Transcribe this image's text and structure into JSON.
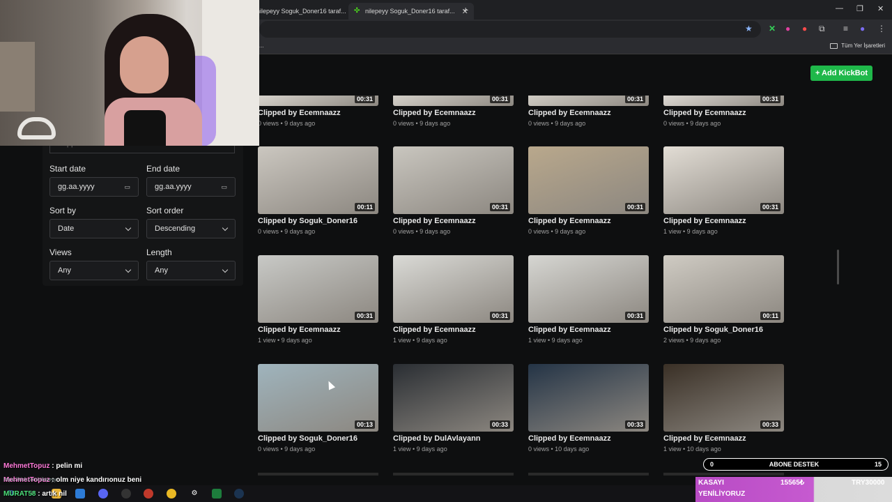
{
  "browser": {
    "tabs": [
      {
        "label": "nilepeyy Soguk_Doner16 taraf..."
      },
      {
        "label": "nilepeyy Soguk_Doner16 taraf..."
      }
    ],
    "new_tab": "+",
    "bookmarks_all": "Tüm Yer İşaretleri",
    "bookmarks_left": "..."
  },
  "header": {
    "add_kickbot": "+ Add KickBot"
  },
  "filters": {
    "clipper_placeholder": "Clipper username",
    "start_date_label": "Start date",
    "start_date_placeholder": "gg.aa.yyyy",
    "end_date_label": "End date",
    "end_date_placeholder": "gg.aa.yyyy",
    "sort_by_label": "Sort by",
    "sort_by_value": "Date",
    "sort_order_label": "Sort order",
    "sort_order_value": "Descending",
    "views_label": "Views",
    "views_value": "Any",
    "length_label": "Length",
    "length_value": "Any"
  },
  "clips": [
    [
      {
        "title": "Clipped by Ecemnaazz",
        "meta": "0 views • 9 days ago",
        "duration": "00:31",
        "tone": "#d8d4cd"
      },
      {
        "title": "Clipped by Ecemnaazz",
        "meta": "0 views • 9 days ago",
        "duration": "00:31",
        "tone": "#d4d0c9"
      },
      {
        "title": "Clipped by Ecemnaazz",
        "meta": "0 views • 9 days ago",
        "duration": "00:31",
        "tone": "#d0ccc4"
      },
      {
        "title": "Clipped by Ecemnaazz",
        "meta": "0 views • 9 days ago",
        "duration": "00:31",
        "tone": "#dcd8d2"
      }
    ],
    [
      {
        "title": "Clipped by Soguk_Doner16",
        "meta": "0 views • 9 days ago",
        "duration": "00:11",
        "tone": "#cbc7c0"
      },
      {
        "title": "Clipped by Ecemnaazz",
        "meta": "0 views • 9 days ago",
        "duration": "00:31",
        "tone": "#c9c6bf"
      },
      {
        "title": "Clipped by Ecemnaazz",
        "meta": "0 views • 9 days ago",
        "duration": "00:31",
        "tone": "#b9a88c"
      },
      {
        "title": "Clipped by Ecemnaazz",
        "meta": "1 view • 9 days ago",
        "duration": "00:31",
        "tone": "#e2ddd5"
      }
    ],
    [
      {
        "title": "Clipped by Ecemnaazz",
        "meta": "1 view • 9 days ago",
        "duration": "00:31",
        "tone": "#c8c9c6"
      },
      {
        "title": "Clipped by Ecemnaazz",
        "meta": "1 view • 9 days ago",
        "duration": "00:31",
        "tone": "#dadad6"
      },
      {
        "title": "Clipped by Ecemnaazz",
        "meta": "1 view • 9 days ago",
        "duration": "00:31",
        "tone": "#d6d6d2"
      },
      {
        "title": "Clipped by Soguk_Doner16",
        "meta": "2 views • 9 days ago",
        "duration": "00:11",
        "tone": "#cfcbc3"
      }
    ],
    [
      {
        "title": "Clipped by Soguk_Doner16",
        "meta": "0 views • 9 days ago",
        "duration": "00:13",
        "tone": "#9fb4bd"
      },
      {
        "title": "Clipped by DulAvlayann",
        "meta": "1 view • 9 days ago",
        "duration": "00:33",
        "tone": "#2a2e33"
      },
      {
        "title": "Clipped by Ecemnaazz",
        "meta": "0 views • 10 days ago",
        "duration": "00:33",
        "tone": "#243446"
      },
      {
        "title": "Clipped by Ecemnaazz",
        "meta": "1 view • 10 days ago",
        "duration": "00:33",
        "tone": "#3a3026"
      }
    ]
  ],
  "chat": [
    {
      "name": "MehmetTopuz",
      "text": " : pelin mi"
    },
    {
      "name": "MehmetTopuz",
      "text": " : olm niye kandırıonuz beni"
    },
    {
      "name": "MURAT58",
      "text": " : artık nil"
    }
  ],
  "chat_url": "https://kick.com/nilepeyy",
  "overlay": {
    "abone_left": "0",
    "abone_label": "ABONE DESTEK",
    "abone_right": "15",
    "kasa_line1": "KASAYI",
    "kasa_line2": "YENİLİYORUZ",
    "kasa_num": "15565₺",
    "kasa_try": "TRY30000"
  },
  "colors": {
    "accent": "#1fb84a",
    "chat_name": "#ff7ad9",
    "kasa_bar": "#c65ad0"
  }
}
